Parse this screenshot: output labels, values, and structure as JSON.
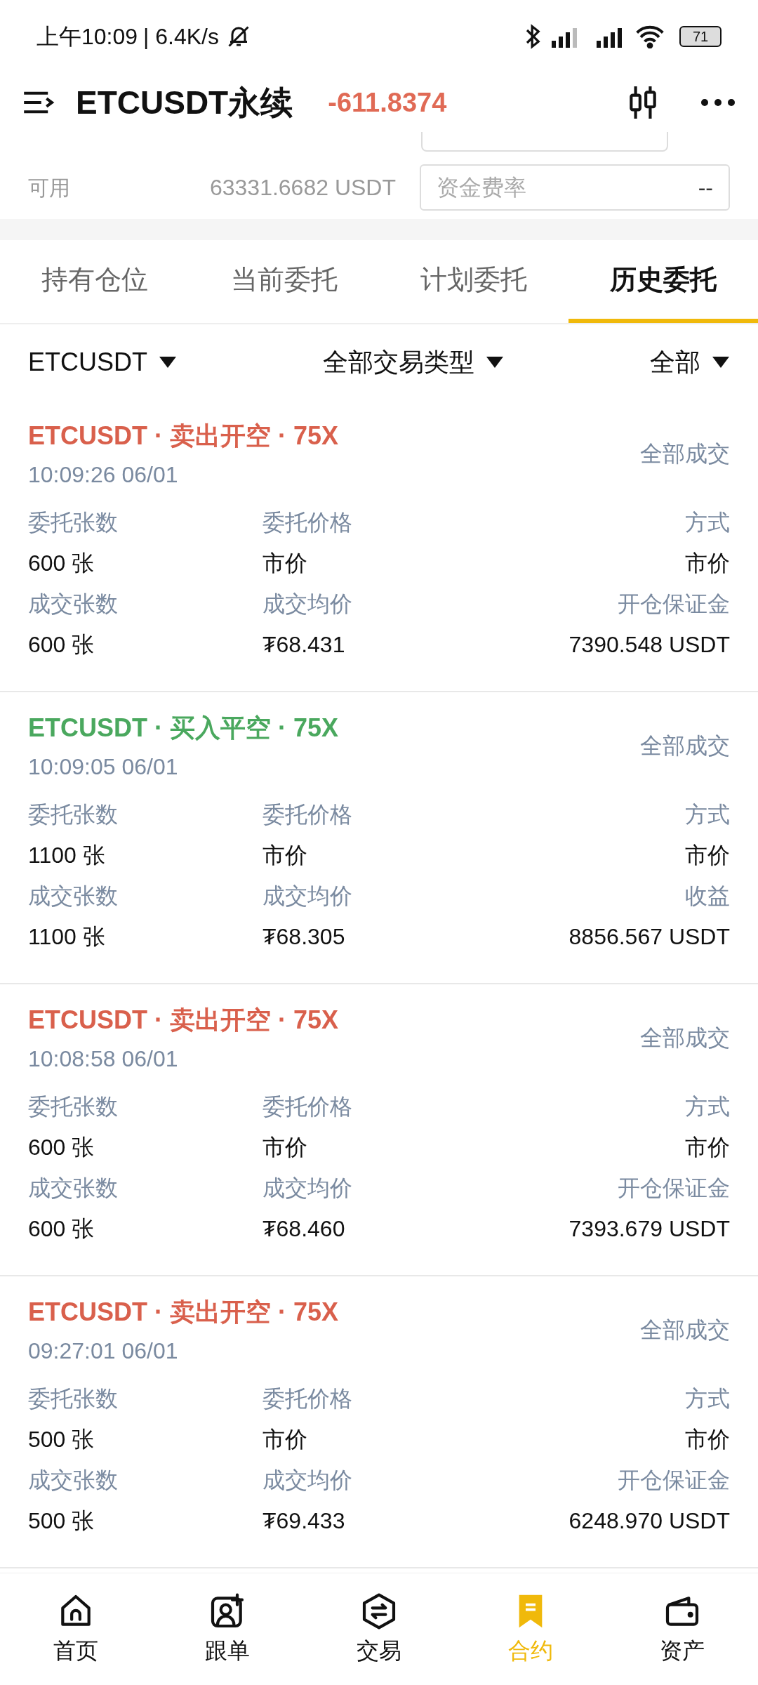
{
  "status_bar": {
    "time": "上午10:09",
    "speed": "| 6.4K/s",
    "battery": "71"
  },
  "header": {
    "title": "ETCUSDT永续",
    "pnl": "-611.8374"
  },
  "account": {
    "label": "可用",
    "value": "63331.6682 USDT",
    "field_placeholder": "资金费率",
    "field_value": "--"
  },
  "tabs": [
    {
      "label": "持有仓位",
      "selected": false
    },
    {
      "label": "当前委托",
      "selected": false
    },
    {
      "label": "计划委托",
      "selected": false
    },
    {
      "label": "历史委托",
      "selected": true
    }
  ],
  "filters": [
    "ETCUSDT",
    "全部交易类型",
    "全部"
  ],
  "orders": [
    {
      "title": "ETCUSDT · 卖出开空 · 75X",
      "kind": "sell",
      "time": "10:09:26 06/01",
      "status": "全部成交",
      "fields": [
        [
          "委托张数",
          "600 张"
        ],
        [
          "委托价格",
          "市价"
        ],
        [
          "方式",
          "市价"
        ],
        [
          "成交张数",
          "600 张"
        ],
        [
          "成交均价",
          "₮68.431"
        ],
        [
          "开仓保证金",
          "7390.548 USDT"
        ]
      ]
    },
    {
      "title": "ETCUSDT · 买入平空 · 75X",
      "kind": "buy",
      "time": "10:09:05 06/01",
      "status": "全部成交",
      "fields": [
        [
          "委托张数",
          "1100 张"
        ],
        [
          "委托价格",
          "市价"
        ],
        [
          "方式",
          "市价"
        ],
        [
          "成交张数",
          "1100 张"
        ],
        [
          "成交均价",
          "₮68.305"
        ],
        [
          "收益",
          "8856.567 USDT"
        ]
      ]
    },
    {
      "title": "ETCUSDT · 卖出开空 · 75X",
      "kind": "sell",
      "time": "10:08:58 06/01",
      "status": "全部成交",
      "fields": [
        [
          "委托张数",
          "600 张"
        ],
        [
          "委托价格",
          "市价"
        ],
        [
          "方式",
          "市价"
        ],
        [
          "成交张数",
          "600 张"
        ],
        [
          "成交均价",
          "₮68.460"
        ],
        [
          "开仓保证金",
          "7393.679 USDT"
        ]
      ]
    },
    {
      "title": "ETCUSDT · 卖出开空 · 75X",
      "kind": "sell",
      "time": "09:27:01 06/01",
      "status": "全部成交",
      "fields": [
        [
          "委托张数",
          "500 张"
        ],
        [
          "委托价格",
          "市价"
        ],
        [
          "方式",
          "市价"
        ],
        [
          "成交张数",
          "500 张"
        ],
        [
          "成交均价",
          "₮69.433"
        ],
        [
          "开仓保证金",
          "6248.970 USDT"
        ]
      ]
    }
  ],
  "nav": [
    {
      "label": "首页",
      "kind": "home",
      "selected": false
    },
    {
      "label": "跟单",
      "kind": "copy",
      "selected": false
    },
    {
      "label": "交易",
      "kind": "trade",
      "selected": false
    },
    {
      "label": "合约",
      "kind": "contract",
      "selected": true
    },
    {
      "label": "资产",
      "kind": "wallet",
      "selected": false
    }
  ]
}
